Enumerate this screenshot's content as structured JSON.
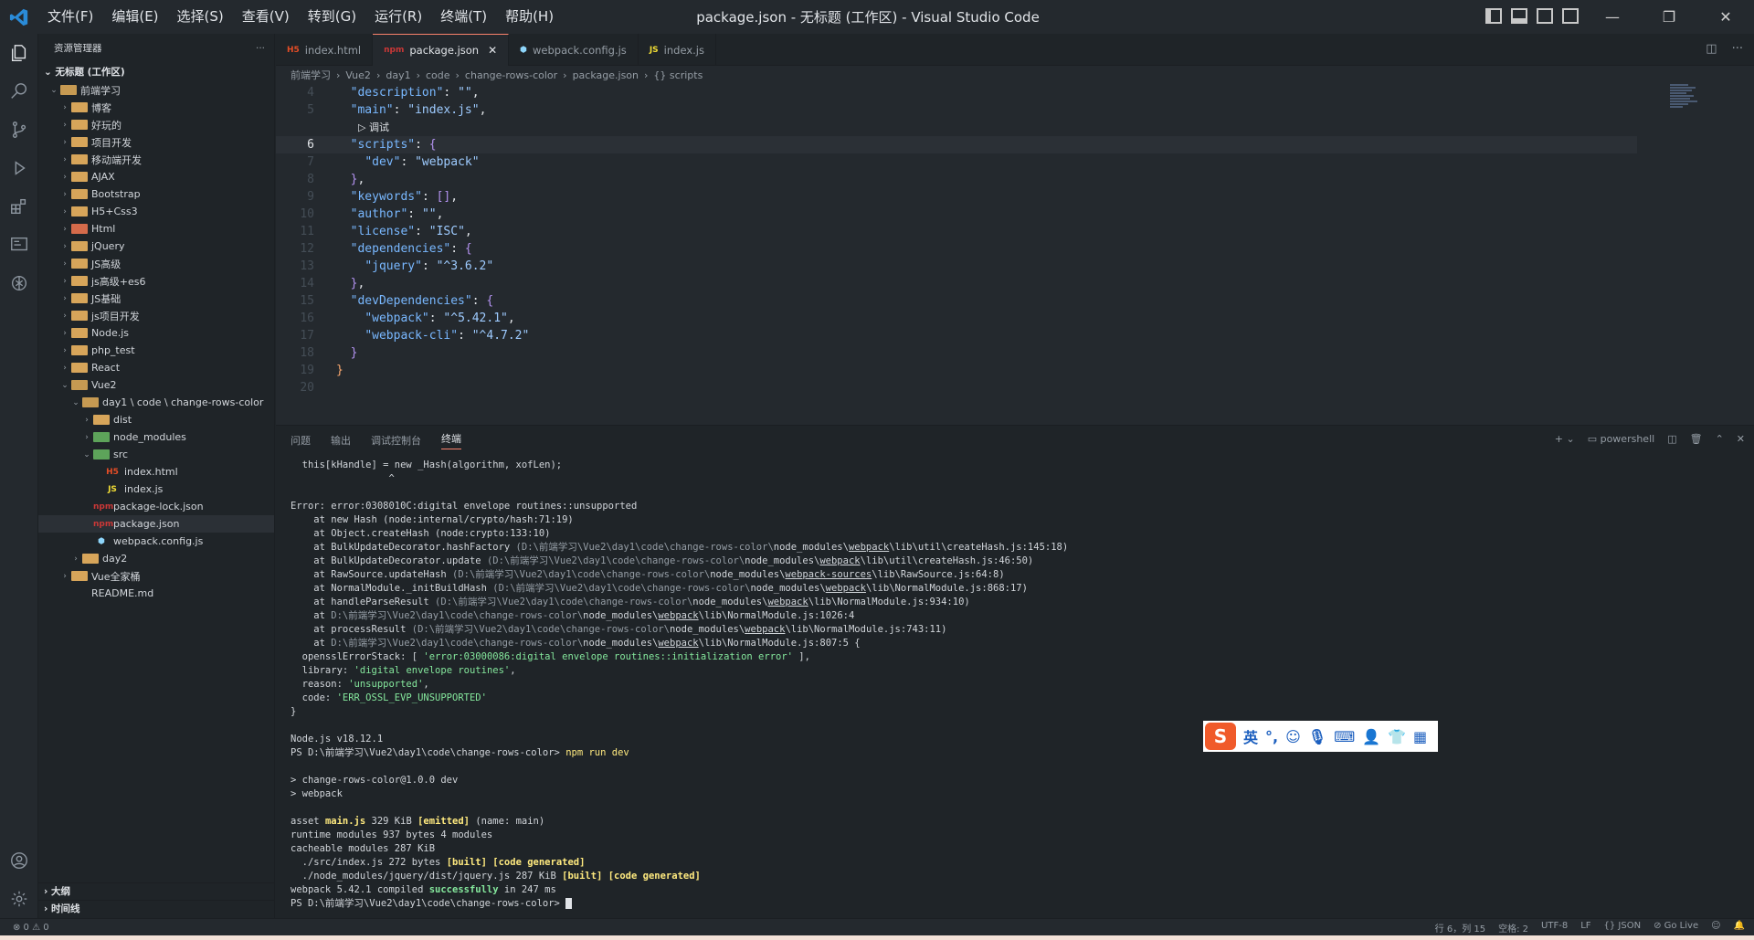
{
  "titlebar": {
    "menu": [
      "文件(F)",
      "编辑(E)",
      "选择(S)",
      "查看(V)",
      "转到(G)",
      "运行(R)",
      "终端(T)",
      "帮助(H)"
    ],
    "title": "package.json - 无标题 (工作区) - Visual Studio Code"
  },
  "sidebar": {
    "header": "资源管理器",
    "workspace": "无标题 (工作区)",
    "root": "前端学习",
    "outline": "大纲",
    "timeline": "时间线"
  },
  "tree": [
    {
      "label": "博客",
      "type": "folder",
      "depth": 1
    },
    {
      "label": "好玩的",
      "type": "folder",
      "depth": 1
    },
    {
      "label": "项目开发",
      "type": "folder",
      "depth": 1
    },
    {
      "label": "移动端开发",
      "type": "folder",
      "depth": 1
    },
    {
      "label": "AJAX",
      "type": "folder",
      "depth": 1
    },
    {
      "label": "Bootstrap",
      "type": "folder",
      "depth": 1
    },
    {
      "label": "H5+Css3",
      "type": "folder",
      "depth": 1
    },
    {
      "label": "Html",
      "type": "folder-red",
      "depth": 1
    },
    {
      "label": "jQuery",
      "type": "folder",
      "depth": 1
    },
    {
      "label": "JS高级",
      "type": "folder",
      "depth": 1
    },
    {
      "label": "js高级+es6",
      "type": "folder",
      "depth": 1
    },
    {
      "label": "JS基础",
      "type": "folder",
      "depth": 1
    },
    {
      "label": "js项目开发",
      "type": "folder",
      "depth": 1
    },
    {
      "label": "Node.js",
      "type": "folder",
      "depth": 1
    },
    {
      "label": "php_test",
      "type": "folder",
      "depth": 1
    },
    {
      "label": "React",
      "type": "folder",
      "depth": 1
    },
    {
      "label": "Vue2",
      "type": "folder-open",
      "depth": 1,
      "open": true
    },
    {
      "label": "day1 \\ code \\ change-rows-color",
      "type": "folder-open",
      "depth": 2,
      "open": true
    },
    {
      "label": "dist",
      "type": "folder",
      "depth": 3
    },
    {
      "label": "node_modules",
      "type": "folder-green",
      "depth": 3
    },
    {
      "label": "src",
      "type": "folder-green",
      "depth": 3,
      "open": true
    },
    {
      "label": "index.html",
      "type": "html",
      "depth": 4
    },
    {
      "label": "index.js",
      "type": "js",
      "depth": 4
    },
    {
      "label": "package-lock.json",
      "type": "npm",
      "depth": 3
    },
    {
      "label": "package.json",
      "type": "npm",
      "depth": 3,
      "selected": true
    },
    {
      "label": "webpack.config.js",
      "type": "webpack",
      "depth": 3
    },
    {
      "label": "day2",
      "type": "folder",
      "depth": 2
    },
    {
      "label": "Vue全家桶",
      "type": "folder",
      "depth": 1
    },
    {
      "label": "README.md",
      "type": "md",
      "depth": 1
    }
  ],
  "tabs": [
    {
      "label": "index.html",
      "icon": "H5",
      "color": "#e44d26",
      "active": false
    },
    {
      "label": "package.json",
      "icon": "npm",
      "color": "#cb3837",
      "active": true
    },
    {
      "label": "webpack.config.js",
      "icon": "⬢",
      "color": "#8ed6fb",
      "active": false
    },
    {
      "label": "index.js",
      "icon": "JS",
      "color": "#f1dd35",
      "active": false
    }
  ],
  "breadcrumb": [
    "前端学习",
    "Vue2",
    "day1",
    "code",
    "change-rows-color",
    "package.json",
    "{} scripts"
  ],
  "editor": {
    "codelens": "▷ 调试",
    "lines": [
      {
        "n": "4",
        "html": "  <span class=\"k\">\"description\"</span>: <span class=\"s\">\"\"</span>,"
      },
      {
        "n": "5",
        "html": "  <span class=\"k\">\"main\"</span>: <span class=\"s\">\"index.js\"</span>,"
      },
      {
        "n": "",
        "lens": true
      },
      {
        "n": "6",
        "html": "  <span class=\"k\">\"scripts\"</span>: <span class=\"b2\">{</span>",
        "current": true
      },
      {
        "n": "7",
        "html": "    <span class=\"k\">\"dev\"</span>: <span class=\"s\">\"webpack\"</span>"
      },
      {
        "n": "8",
        "html": "  <span class=\"b2\">}</span>,"
      },
      {
        "n": "9",
        "html": "  <span class=\"k\">\"keywords\"</span>: <span class=\"b2\">[]</span>,"
      },
      {
        "n": "10",
        "html": "  <span class=\"k\">\"author\"</span>: <span class=\"s\">\"\"</span>,"
      },
      {
        "n": "11",
        "html": "  <span class=\"k\">\"license\"</span>: <span class=\"s\">\"ISC\"</span>,"
      },
      {
        "n": "12",
        "html": "  <span class=\"k\">\"dependencies\"</span>: <span class=\"b2\">{</span>"
      },
      {
        "n": "13",
        "html": "    <span class=\"k\">\"jquery\"</span>: <span class=\"s\">\"^3.6.2\"</span>"
      },
      {
        "n": "14",
        "html": "  <span class=\"b2\">}</span>,"
      },
      {
        "n": "15",
        "html": "  <span class=\"k\">\"devDependencies\"</span>: <span class=\"b2\">{</span>"
      },
      {
        "n": "16",
        "html": "    <span class=\"k\">\"webpack\"</span>: <span class=\"s\">\"^5.42.1\"</span>,"
      },
      {
        "n": "17",
        "html": "    <span class=\"k\">\"webpack-cli\"</span>: <span class=\"s\">\"^4.7.2\"</span>"
      },
      {
        "n": "18",
        "html": "  <span class=\"b2\">}</span>"
      },
      {
        "n": "19",
        "html": "<span class=\"b1\">}</span>"
      },
      {
        "n": "20",
        "html": ""
      }
    ]
  },
  "panel": {
    "tabs": [
      "问题",
      "输出",
      "调试控制台",
      "终端"
    ],
    "active_tab": "终端",
    "shell": "powershell",
    "terminal": [
      "  this[kHandle] = new _Hash(algorithm, xofLen);",
      "                 ^",
      "",
      "Error: error:0308010C:digital envelope routines::unsupported",
      "    at new Hash (node:internal/crypto/hash:71:19)",
      "    at Object.createHash (node:crypto:133:10)",
      "    at BulkUpdateDecorator.hashFactory <span class=\"dim\">(D:\\前端学习\\Vue2\\day1\\code\\change-rows-color\\</span>node_modules\\<span class=\"u\">webpack</span>\\lib\\util\\createHash.js:145:18)",
      "    at BulkUpdateDecorator.update <span class=\"dim\">(D:\\前端学习\\Vue2\\day1\\code\\change-rows-color\\</span>node_modules\\<span class=\"u\">webpack</span>\\lib\\util\\createHash.js:46:50)",
      "    at RawSource.updateHash <span class=\"dim\">(D:\\前端学习\\Vue2\\day1\\code\\change-rows-color\\</span>node_modules\\<span class=\"u\">webpack-sources</span>\\lib\\RawSource.js:64:8)",
      "    at NormalModule._initBuildHash <span class=\"dim\">(D:\\前端学习\\Vue2\\day1\\code\\change-rows-color\\</span>node_modules\\<span class=\"u\">webpack</span>\\lib\\NormalModule.js:868:17)",
      "    at handleParseResult <span class=\"dim\">(D:\\前端学习\\Vue2\\day1\\code\\change-rows-color\\</span>node_modules\\<span class=\"u\">webpack</span>\\lib\\NormalModule.js:934:10)",
      "    at <span class=\"dim\">D:\\前端学习\\Vue2\\day1\\code\\change-rows-color\\</span>node_modules\\<span class=\"u\">webpack</span>\\lib\\NormalModule.js:1026:4",
      "    at processResult <span class=\"dim\">(D:\\前端学习\\Vue2\\day1\\code\\change-rows-color\\</span>node_modules\\<span class=\"u\">webpack</span>\\lib\\NormalModule.js:743:11)",
      "    at <span class=\"dim\">D:\\前端学习\\Vue2\\day1\\code\\change-rows-color\\</span>node_modules\\<span class=\"u\">webpack</span>\\lib\\NormalModule.js:807:5 {",
      "  opensslErrorStack: [ <span class=\"gr\">'error:03000086:digital envelope routines::initialization error'</span> ],",
      "  library: <span class=\"gr\">'digital envelope routines'</span>,",
      "  reason: <span class=\"gr\">'unsupported'</span>,",
      "  code: <span class=\"gr\">'ERR_OSSL_EVP_UNSUPPORTED'</span>",
      "}",
      "",
      "Node.js v18.12.1",
      "PS D:\\前端学习\\Vue2\\day1\\code\\change-rows-color> <span class=\"y\" style=\"font-weight:normal\">npm run dev</span>",
      "",
      "> change-rows-color@1.0.0 dev",
      "> webpack",
      "",
      "asset <span class=\"y\">main.js</span> 329 KiB <span class=\"y\">[emitted]</span> (name: main)",
      "runtime modules 937 bytes 4 modules",
      "cacheable modules 287 KiB",
      "  ./src/index.js 272 bytes <span class=\"y\">[built]</span> <span class=\"y\">[code generated]</span>",
      "  ./node_modules/jquery/dist/jquery.js 287 KiB <span class=\"y\">[built]</span> <span class=\"y\">[code generated]</span>",
      "webpack 5.42.1 compiled <span class=\"g\" style=\"font-weight:bold\">successfully</span> in 247 ms",
      "PS D:\\前端学习\\Vue2\\day1\\code\\change-rows-color> <span class=\"cur-block\"></span>"
    ]
  },
  "ime": {
    "logo": "S",
    "mode": "英"
  },
  "statusbar": {
    "errors": "⊗ 0 ⚠ 0",
    "position": "行 6，列 15",
    "spaces": "空格: 2",
    "encoding": "UTF-8",
    "eol": "LF",
    "language": "{} JSON",
    "golive": "Go Live"
  }
}
